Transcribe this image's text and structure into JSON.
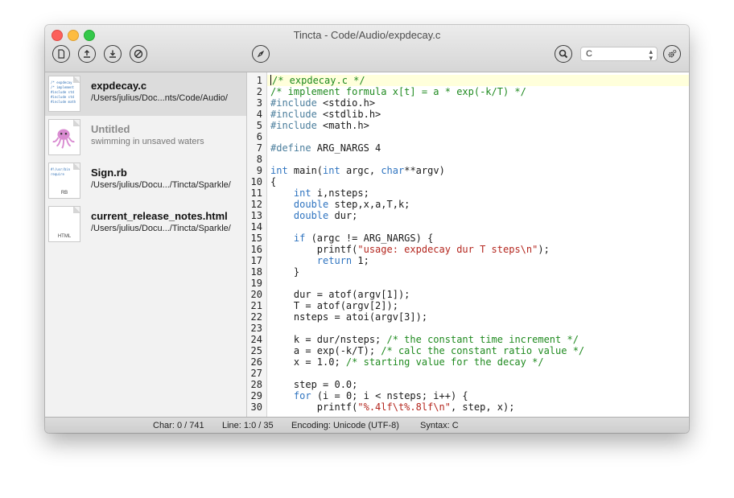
{
  "window": {
    "title": "Tincta - Code/Audio/expdecay.c"
  },
  "toolbar": {
    "buttons": [
      {
        "name": "new-document-button",
        "icon": "document-icon"
      },
      {
        "name": "upload-button",
        "icon": "upload-icon"
      },
      {
        "name": "download-button",
        "icon": "download-icon"
      },
      {
        "name": "stop-button",
        "icon": "no-entry-icon"
      },
      {
        "name": "compass-button",
        "icon": "compass-icon"
      },
      {
        "name": "search-button",
        "icon": "magnifier-icon"
      },
      {
        "name": "settings-button",
        "icon": "gear-icon"
      }
    ],
    "syntax_value": "C"
  },
  "sidebar": {
    "items": [
      {
        "name": "expdecay.c",
        "path": "/Users/julius/Doc...nts/Code/Audio/",
        "selected": true
      },
      {
        "name": "Untitled",
        "path": "swimming in unsaved waters",
        "selected": false
      },
      {
        "name": "Sign.rb",
        "path": "/Users/julius/Docu.../Tincta/Sparkle/",
        "selected": false,
        "ext": "RB"
      },
      {
        "name": "current_release_notes.html",
        "path": "/Users/julius/Docu.../Tincta/Sparkle/",
        "selected": false,
        "ext": "HTML"
      }
    ]
  },
  "editor": {
    "lines": [
      [
        {
          "t": "/* expdecay.c */",
          "c": "cm"
        }
      ],
      [
        {
          "t": "/* implement formula x[t] = a * exp(-k/T) */",
          "c": "cm"
        }
      ],
      [
        {
          "t": "#include",
          "c": "pp"
        },
        {
          "t": " <stdio.h>",
          "c": ""
        }
      ],
      [
        {
          "t": "#include",
          "c": "pp"
        },
        {
          "t": " <stdlib.h>",
          "c": ""
        }
      ],
      [
        {
          "t": "#include",
          "c": "pp"
        },
        {
          "t": " <math.h>",
          "c": ""
        }
      ],
      [],
      [
        {
          "t": "#define",
          "c": "pp"
        },
        {
          "t": " ARG_NARGS 4",
          "c": ""
        }
      ],
      [],
      [
        {
          "t": "int",
          "c": "kw"
        },
        {
          "t": " main(",
          "c": ""
        },
        {
          "t": "int",
          "c": "kw"
        },
        {
          "t": " argc, ",
          "c": ""
        },
        {
          "t": "char",
          "c": "kw"
        },
        {
          "t": "**argv)",
          "c": ""
        }
      ],
      [
        {
          "t": "{",
          "c": ""
        }
      ],
      [
        {
          "t": "    ",
          "c": ""
        },
        {
          "t": "int",
          "c": "kw"
        },
        {
          "t": " i,nsteps;",
          "c": ""
        }
      ],
      [
        {
          "t": "    ",
          "c": ""
        },
        {
          "t": "double",
          "c": "kw"
        },
        {
          "t": " step,x,a,T,k;",
          "c": ""
        }
      ],
      [
        {
          "t": "    ",
          "c": ""
        },
        {
          "t": "double",
          "c": "kw"
        },
        {
          "t": " dur;",
          "c": ""
        }
      ],
      [],
      [
        {
          "t": "    ",
          "c": ""
        },
        {
          "t": "if",
          "c": "kw"
        },
        {
          "t": " (argc != ARG_NARGS) {",
          "c": ""
        }
      ],
      [
        {
          "t": "        printf(",
          "c": ""
        },
        {
          "t": "\"usage: expdecay dur T steps\\n\"",
          "c": "str"
        },
        {
          "t": ");",
          "c": ""
        }
      ],
      [
        {
          "t": "        ",
          "c": ""
        },
        {
          "t": "return",
          "c": "kw"
        },
        {
          "t": " 1;",
          "c": ""
        }
      ],
      [
        {
          "t": "    }",
          "c": ""
        }
      ],
      [],
      [
        {
          "t": "    dur = atof(argv[1]);",
          "c": ""
        }
      ],
      [
        {
          "t": "    T = atof(argv[2]);",
          "c": ""
        }
      ],
      [
        {
          "t": "    nsteps = atoi(argv[3]);",
          "c": ""
        }
      ],
      [],
      [
        {
          "t": "    k = dur/nsteps; ",
          "c": ""
        },
        {
          "t": "/* the constant time increment */",
          "c": "cm"
        }
      ],
      [
        {
          "t": "    a = exp(-k/T); ",
          "c": ""
        },
        {
          "t": "/* calc the constant ratio value */",
          "c": "cm"
        }
      ],
      [
        {
          "t": "    x = 1.0; ",
          "c": ""
        },
        {
          "t": "/* starting value for the decay */",
          "c": "cm"
        }
      ],
      [],
      [
        {
          "t": "    step = 0.0;",
          "c": ""
        }
      ],
      [
        {
          "t": "    ",
          "c": ""
        },
        {
          "t": "for",
          "c": "kw"
        },
        {
          "t": " (i = 0; i < nsteps; i++) {",
          "c": ""
        }
      ],
      [
        {
          "t": "        printf(",
          "c": ""
        },
        {
          "t": "\"%.4lf\\t%.8lf\\n\"",
          "c": "str"
        },
        {
          "t": ", step, x);",
          "c": ""
        }
      ]
    ]
  },
  "status": {
    "char": "Char: 0 / 741",
    "line": "Line: 1:0 / 35",
    "encoding": "Encoding: Unicode (UTF-8)",
    "syntax": "Syntax: C"
  }
}
